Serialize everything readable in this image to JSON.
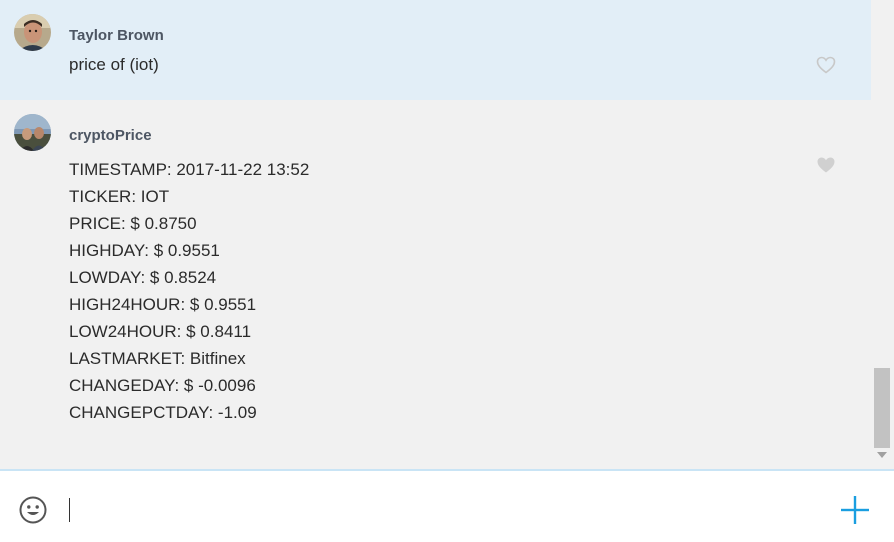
{
  "colors": {
    "accent": "#1a9ee0",
    "own_message_bg": "#e2eef7",
    "other_message_bg": "#f1f1f1",
    "heart_outline": "#c8c8c8",
    "heart_filled": "#d0d0d0"
  },
  "messages": [
    {
      "sender": "Taylor Brown",
      "text": "price of (iot)",
      "avatar_icon": "user-photo-avatar",
      "heart_icon": "heart-outline-icon"
    },
    {
      "sender": "cryptoPrice",
      "lines": [
        "TIMESTAMP: 2017-11-22 13:52",
        "TICKER: IOT",
        "PRICE: $ 0.8750",
        "HIGHDAY: $ 0.9551",
        "LOWDAY: $ 0.8524",
        "HIGH24HOUR: $ 0.9551",
        "LOW24HOUR: $ 0.8411",
        "LASTMARKET: Bitfinex",
        "CHANGEDAY: $ -0.0096",
        "CHANGEPCTDAY: -1.09"
      ],
      "avatar_icon": "bot-photo-avatar",
      "heart_icon": "heart-filled-icon"
    }
  ],
  "composer": {
    "input_value": "",
    "emoji_icon": "emoji-smile-icon",
    "add_icon": "plus-icon"
  }
}
